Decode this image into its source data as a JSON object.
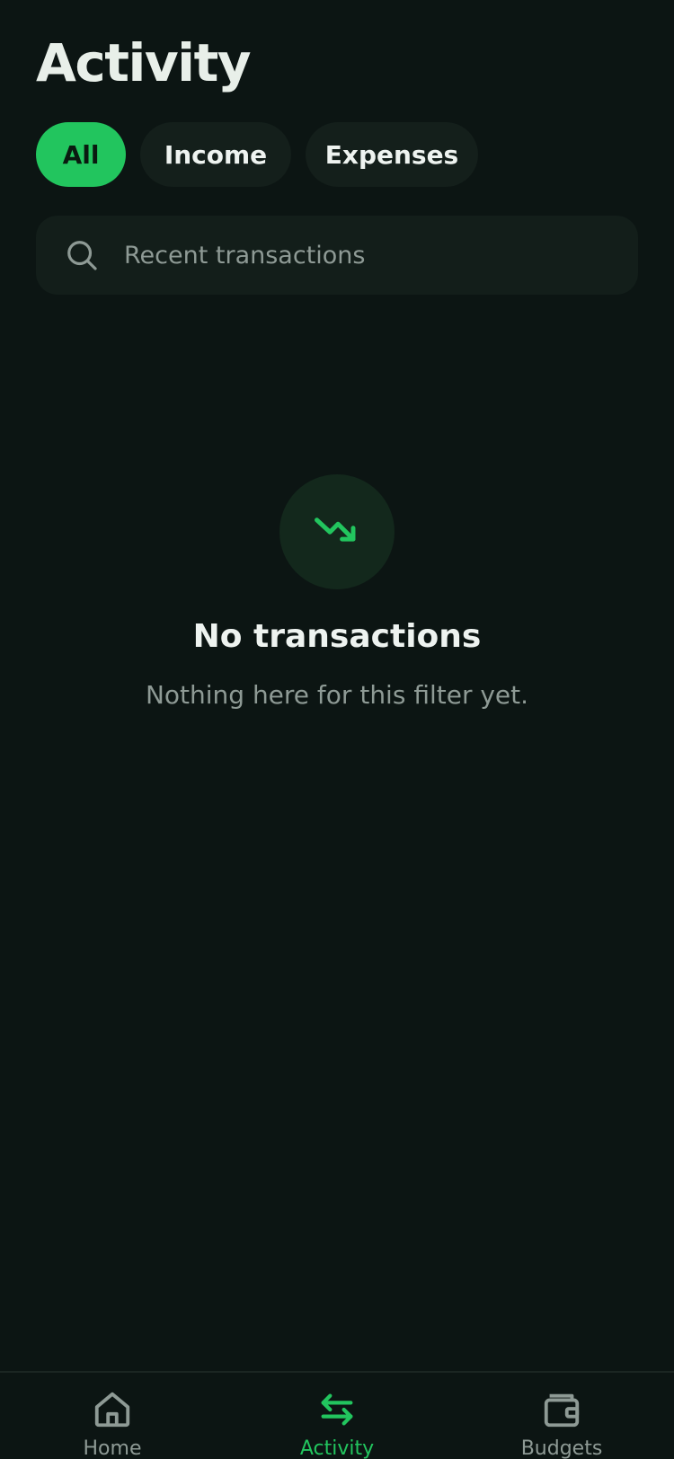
{
  "page": {
    "title": "Activity"
  },
  "filters": {
    "items": [
      {
        "label": "All",
        "active": true
      },
      {
        "label": "Income",
        "active": false
      },
      {
        "label": "Expenses",
        "active": false
      }
    ]
  },
  "search": {
    "placeholder": "Recent transactions",
    "value": "",
    "icon": "search-icon"
  },
  "empty_state": {
    "icon": "trending-down-icon",
    "title": "No transactions",
    "subtitle": "Nothing here for this filter yet."
  },
  "bottom_nav": {
    "items": [
      {
        "label": "Home",
        "icon": "home-icon",
        "active": false
      },
      {
        "label": "Activity",
        "icon": "swap-arrows-icon",
        "active": true
      },
      {
        "label": "Budgets",
        "icon": "wallet-icon",
        "active": false
      }
    ]
  },
  "colors": {
    "background": "#0c1513",
    "accent": "#22c55e",
    "surface": "#141f1b",
    "muted_text": "#8e9a95"
  }
}
